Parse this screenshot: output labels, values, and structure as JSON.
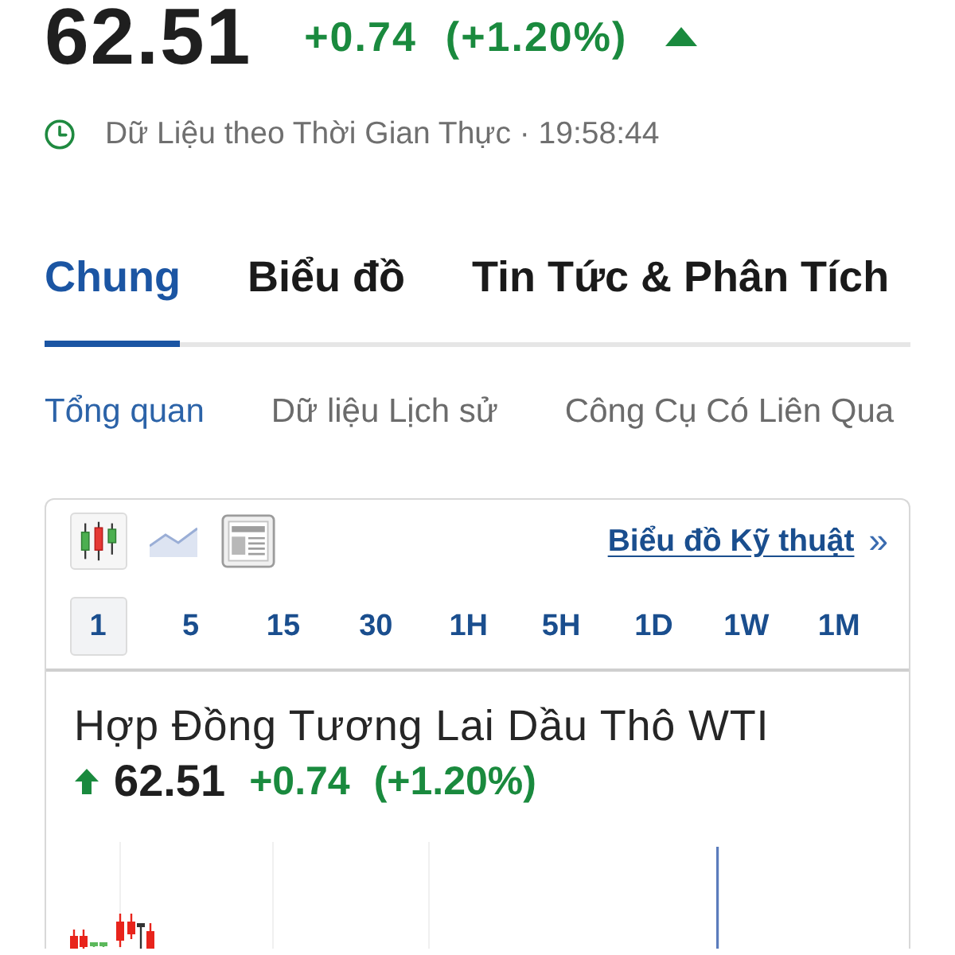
{
  "quote": {
    "price": "62.51",
    "change": "+0.74",
    "change_percent": "(+1.20%)",
    "rising": true
  },
  "realtime_status": {
    "text": "Dữ Liệu theo Thời Gian Thực · 19:58:44"
  },
  "tabs": [
    {
      "label": "Chung",
      "selected": true
    },
    {
      "label": "Biểu đồ",
      "selected": false
    },
    {
      "label": "Tin Tức & Phân Tích",
      "selected": false
    }
  ],
  "subtabs": [
    {
      "label": "Tổng quan",
      "selected": true
    },
    {
      "label": "Dữ liệu Lịch sử",
      "selected": false
    },
    {
      "label": "Công Cụ Có Liên Qua",
      "selected": false
    }
  ],
  "chart_widget": {
    "chart_types": [
      {
        "kind": "candlestick",
        "selected": true
      },
      {
        "kind": "line",
        "selected": false
      },
      {
        "kind": "table",
        "selected": false
      }
    ],
    "technical_chart_link": {
      "label": "Biểu đồ Kỹ thuật",
      "chevron": "»"
    },
    "timeframes": [
      {
        "label": "1",
        "selected": true
      },
      {
        "label": "5",
        "selected": false
      },
      {
        "label": "15",
        "selected": false
      },
      {
        "label": "30",
        "selected": false
      },
      {
        "label": "1H",
        "selected": false
      },
      {
        "label": "5H",
        "selected": false
      },
      {
        "label": "1D",
        "selected": false
      },
      {
        "label": "1W",
        "selected": false
      },
      {
        "label": "1M",
        "selected": false
      }
    ],
    "instrument": {
      "name": "Hợp Đồng Tương Lai Dầu Thô WTI",
      "price": "62.51",
      "change": "+0.74",
      "change_percent": "(+1.20%)",
      "rising": true
    }
  }
}
